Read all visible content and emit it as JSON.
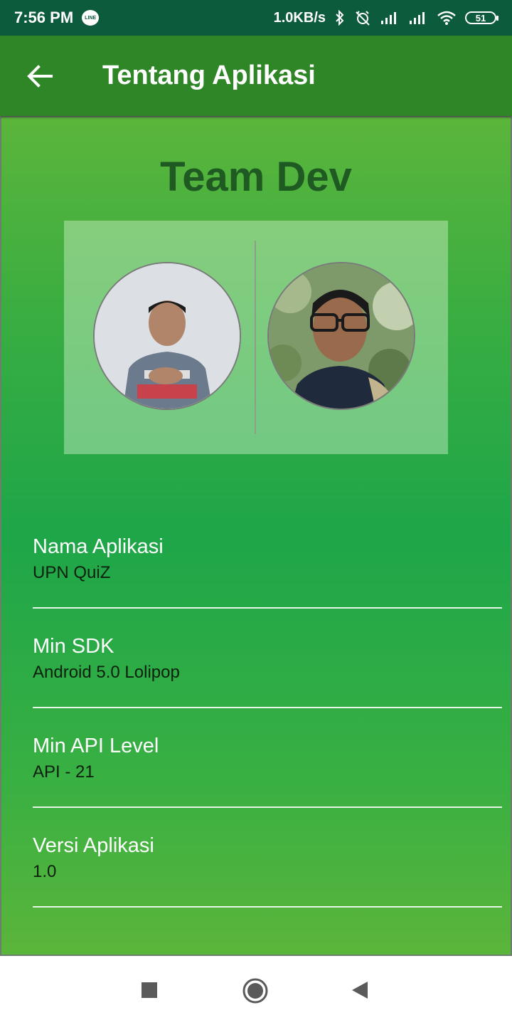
{
  "status_bar": {
    "time": "7:56 PM",
    "line_app_label": "LINE",
    "net_speed": "1.0KB/s",
    "battery_level": "51",
    "icons": [
      "line-icon",
      "bluetooth-icon",
      "alarm-off-icon",
      "signal-icon",
      "signal-icon",
      "wifi-icon",
      "battery-icon"
    ]
  },
  "app_bar": {
    "title": "Tentang Aplikasi",
    "back_icon": "arrow-left-icon"
  },
  "team": {
    "title": "Team Dev",
    "members": [
      {
        "avatar": "developer-photo-1"
      },
      {
        "avatar": "developer-photo-2"
      }
    ]
  },
  "info": [
    {
      "label": "Nama Aplikasi",
      "value": "UPN QuiZ"
    },
    {
      "label": "Min SDK",
      "value": "Android 5.0 Lolipop"
    },
    {
      "label": "Min API Level",
      "value": "API - 21"
    },
    {
      "label": "Versi Aplikasi",
      "value": "1.0"
    }
  ],
  "colors": {
    "status_bar": "#0b5b3c",
    "app_bar": "#2e8627",
    "title_text": "#1f5a22",
    "accent_green": "#1ea649"
  },
  "nav_bar": {
    "icons": [
      "recent-apps-icon",
      "home-icon",
      "back-triangle-icon"
    ]
  }
}
